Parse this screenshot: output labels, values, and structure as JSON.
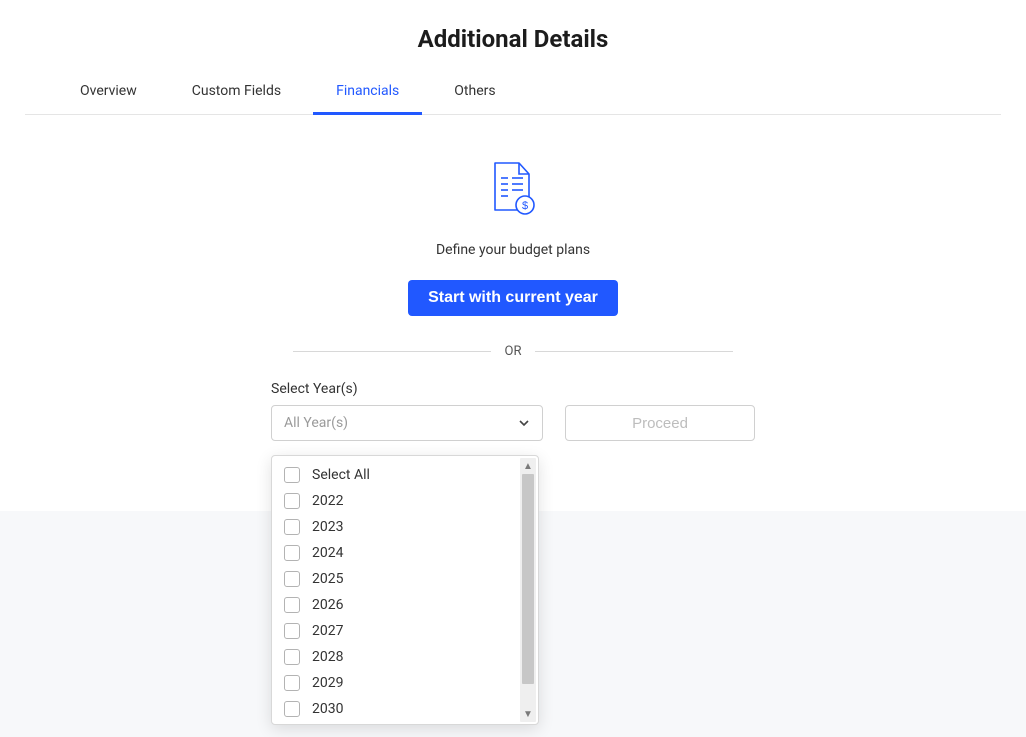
{
  "title": "Additional Details",
  "tabs": [
    {
      "id": "overview",
      "label": "Overview"
    },
    {
      "id": "custom-fields",
      "label": "Custom Fields"
    },
    {
      "id": "financials",
      "label": "Financials"
    },
    {
      "id": "others",
      "label": "Others"
    }
  ],
  "active_tab": "financials",
  "hint": "Define your budget plans",
  "primary_button": "Start with current year",
  "or_label": "OR",
  "year_select": {
    "label": "Select Year(s)",
    "placeholder": "All Year(s)",
    "select_all_label": "Select All",
    "options": [
      "2022",
      "2023",
      "2024",
      "2025",
      "2026",
      "2027",
      "2028",
      "2029",
      "2030"
    ]
  },
  "proceed_label": "Proceed",
  "colors": {
    "primary": "#2158ff"
  }
}
